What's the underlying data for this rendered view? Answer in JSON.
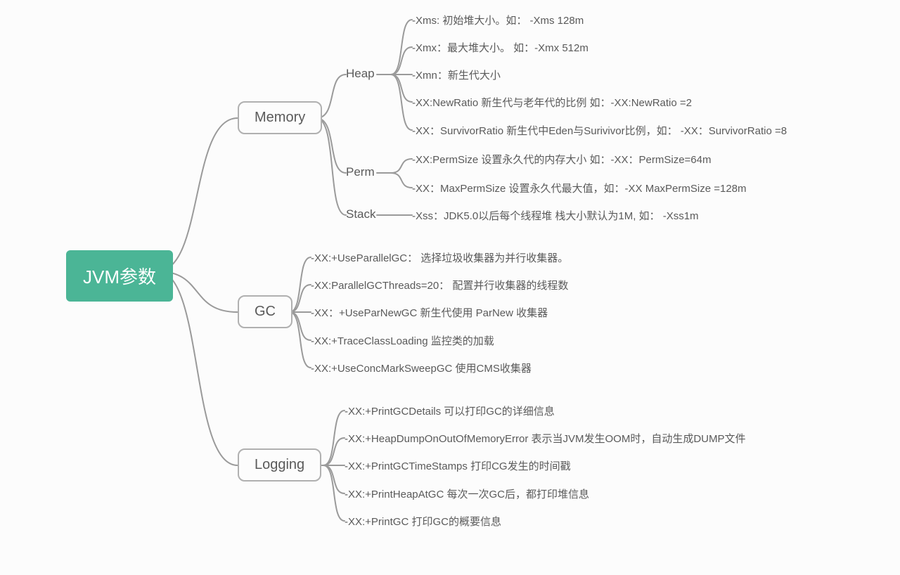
{
  "root": {
    "label": "JVM参数"
  },
  "memory": {
    "label": "Memory",
    "heap": {
      "label": "Heap",
      "items": [
        "-Xms: 初始堆大小。如：  -Xms 128m",
        "-Xmx：最大堆大小。 如：-Xmx 512m",
        "-Xmn：新生代大小",
        "-XX:NewRatio  新生代与老年代的比例 如：-XX:NewRatio =2",
        "-XX：SurvivorRatio 新生代中Eden与Surivivor比例，如： -XX：SurvivorRatio =8"
      ]
    },
    "perm": {
      "label": "Perm",
      "items": [
        "-XX:PermSize  设置永久代的内存大小 如：-XX：PermSize=64m",
        "-XX：MaxPermSize 设置永久代最大值，如：-XX MaxPermSize =128m"
      ]
    },
    "stack": {
      "label": "Stack",
      "items": [
        "-Xss：JDK5.0以后每个线程堆 栈大小默认为1M, 如： -Xss1m"
      ]
    }
  },
  "gc": {
    "label": "GC",
    "items": [
      "-XX:+UseParallelGC： 选择垃圾收集器为并行收集器。",
      "-XX:ParallelGCThreads=20： 配置并行收集器的线程数",
      "-XX：+UseParNewGC 新生代使用 ParNew 收集器",
      "-XX:+TraceClassLoading 监控类的加载",
      "-XX:+UseConcMarkSweepGC 使用CMS收集器"
    ]
  },
  "logging": {
    "label": "Logging",
    "items": [
      "-XX:+PrintGCDetails 可以打印GC的详细信息",
      "-XX:+HeapDumpOnOutOfMemoryError 表示当JVM发生OOM时，自动生成DUMP文件",
      "-XX:+PrintGCTimeStamps 打印CG发生的时间戳",
      "-XX:+PrintHeapAtGC 每次一次GC后，都打印堆信息",
      "-XX:+PrintGC 打印GC的概要信息"
    ]
  }
}
